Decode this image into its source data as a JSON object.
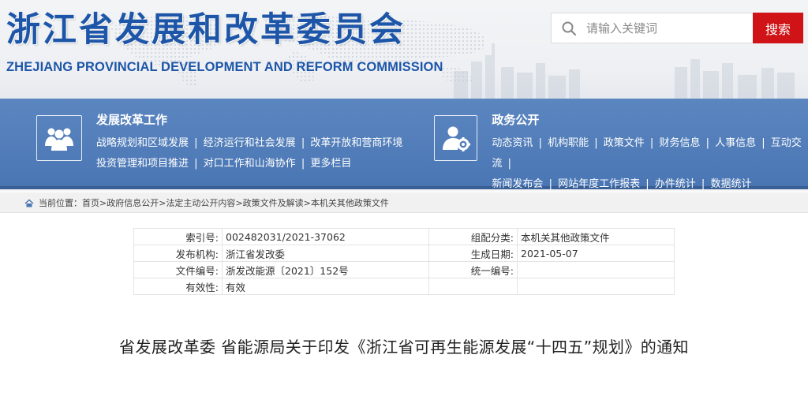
{
  "header": {
    "title_cn": "浙江省发展和改革委员会",
    "title_en": "ZHEJIANG PROVINCIAL DEVELOPMENT AND REFORM COMMISSION"
  },
  "search": {
    "placeholder": "请输入关键词",
    "button_label": "搜索",
    "button_color": "#cf1316"
  },
  "nav": {
    "band_color": "#4a76b4",
    "groups": [
      {
        "heading": "发展改革工作",
        "icon": "people-group-icon",
        "lines": [
          [
            "战略规划和区域发展",
            "经济运行和社会发展",
            "改革开放和营商环境"
          ],
          [
            "投资管理和项目推进",
            "对口工作和山海协作",
            "更多栏目"
          ]
        ]
      },
      {
        "heading": "政务公开",
        "icon": "person-gear-icon",
        "lines": [
          [
            "动态资讯",
            "机构职能",
            "政策文件",
            "财务信息",
            "人事信息",
            "互动交流"
          ],
          [
            "新闻发布会",
            "网站年度工作报表",
            "办件统计",
            "数据统计"
          ]
        ]
      }
    ]
  },
  "breadcrumb": {
    "prefix": "当前位置：",
    "items": [
      "首页",
      "政府信息公开",
      "法定主动公开内容",
      "政策文件及解读",
      "本机关其他政策文件"
    ]
  },
  "meta": {
    "rows": [
      [
        "索引号:",
        "002482031/2021-37062",
        "组配分类:",
        "本机关其他政策文件"
      ],
      [
        "发布机构:",
        "浙江省发改委",
        "生成日期:",
        "2021-05-07"
      ],
      [
        "文件编号:",
        "浙发改能源〔2021〕152号",
        "统一编号:",
        ""
      ],
      [
        "有效性:",
        "有效",
        "",
        ""
      ]
    ]
  },
  "article": {
    "title": "省发展改革委 省能源局关于印发《浙江省可再生能源发展“十四五”规划》的通知"
  }
}
